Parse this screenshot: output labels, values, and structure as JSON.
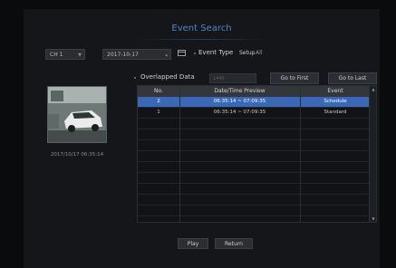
{
  "window": {
    "title": "Event Search"
  },
  "filters": {
    "channel": "CH 1",
    "date": "2017-10-17",
    "event_type_label": "Event Type",
    "event_type_setup": "Setup",
    "event_type_value": "All"
  },
  "overlap": {
    "label": "Overlapped Data",
    "value": "1440"
  },
  "buttons": {
    "go_first": "Go to First",
    "go_last": "Go to Last",
    "play": "Play",
    "return": "Return"
  },
  "preview": {
    "timestamp": "2017/10/17 06:35:14"
  },
  "table": {
    "headers": {
      "no": "No.",
      "datetime": "Date/Time Preview",
      "event": "Event"
    },
    "rows": [
      {
        "no": "2",
        "datetime": "06:35:14 ~ 07:09:35",
        "event": "Schedule",
        "selected": true
      },
      {
        "no": "1",
        "datetime": "06:35:14 ~ 07:09:35",
        "event": "Standard",
        "selected": false
      }
    ]
  },
  "colors": {
    "accent": "#4f86c6",
    "selected_row": "#3a67b6"
  },
  "icons": {
    "calendar": "calendar-icon",
    "dropdown": "chevron-down-icon"
  }
}
